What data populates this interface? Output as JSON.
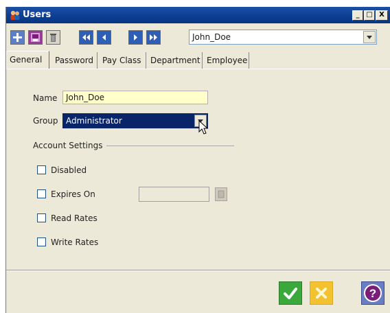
{
  "window": {
    "title": "Users",
    "controls": {
      "minimize": "_",
      "restore": "□",
      "close": "X"
    }
  },
  "toolbar": {
    "buttons": [
      {
        "name": "add",
        "icon": "plus-icon"
      },
      {
        "name": "save",
        "icon": "save-icon"
      },
      {
        "name": "delete",
        "icon": "trash-icon"
      },
      {
        "name": "first",
        "icon": "first-record-icon"
      },
      {
        "name": "previous",
        "icon": "previous-record-icon"
      },
      {
        "name": "next",
        "icon": "next-record-icon"
      },
      {
        "name": "last",
        "icon": "last-record-icon"
      }
    ],
    "record_select": {
      "value": "John_Doe"
    }
  },
  "tabs": [
    "General",
    "Password",
    "Pay Class",
    "Department",
    "Employee"
  ],
  "active_tab": "General",
  "form": {
    "name": {
      "label": "Name",
      "value": "John_Doe"
    },
    "group": {
      "label": "Group",
      "value": "Administrator"
    },
    "account_settings": {
      "title": "Account Settings",
      "disabled": {
        "label": "Disabled",
        "checked": false
      },
      "expires_on": {
        "label": "Expires On",
        "checked": false,
        "value": ""
      },
      "read_rates": {
        "label": "Read Rates",
        "checked": false
      },
      "write_rates": {
        "label": "Write Rates",
        "checked": false
      }
    }
  },
  "footer": {
    "ok_icon": "checkmark-icon",
    "cancel_icon": "cancel-x-icon",
    "help_icon": "question-mark-icon"
  },
  "colors": {
    "titlebar": "#0b3d91",
    "selection": "#0a246a",
    "name_field": "#ffffcc",
    "ok": "#3aa83a",
    "cancel": "#f2c230",
    "help": "#7a1c7a"
  }
}
